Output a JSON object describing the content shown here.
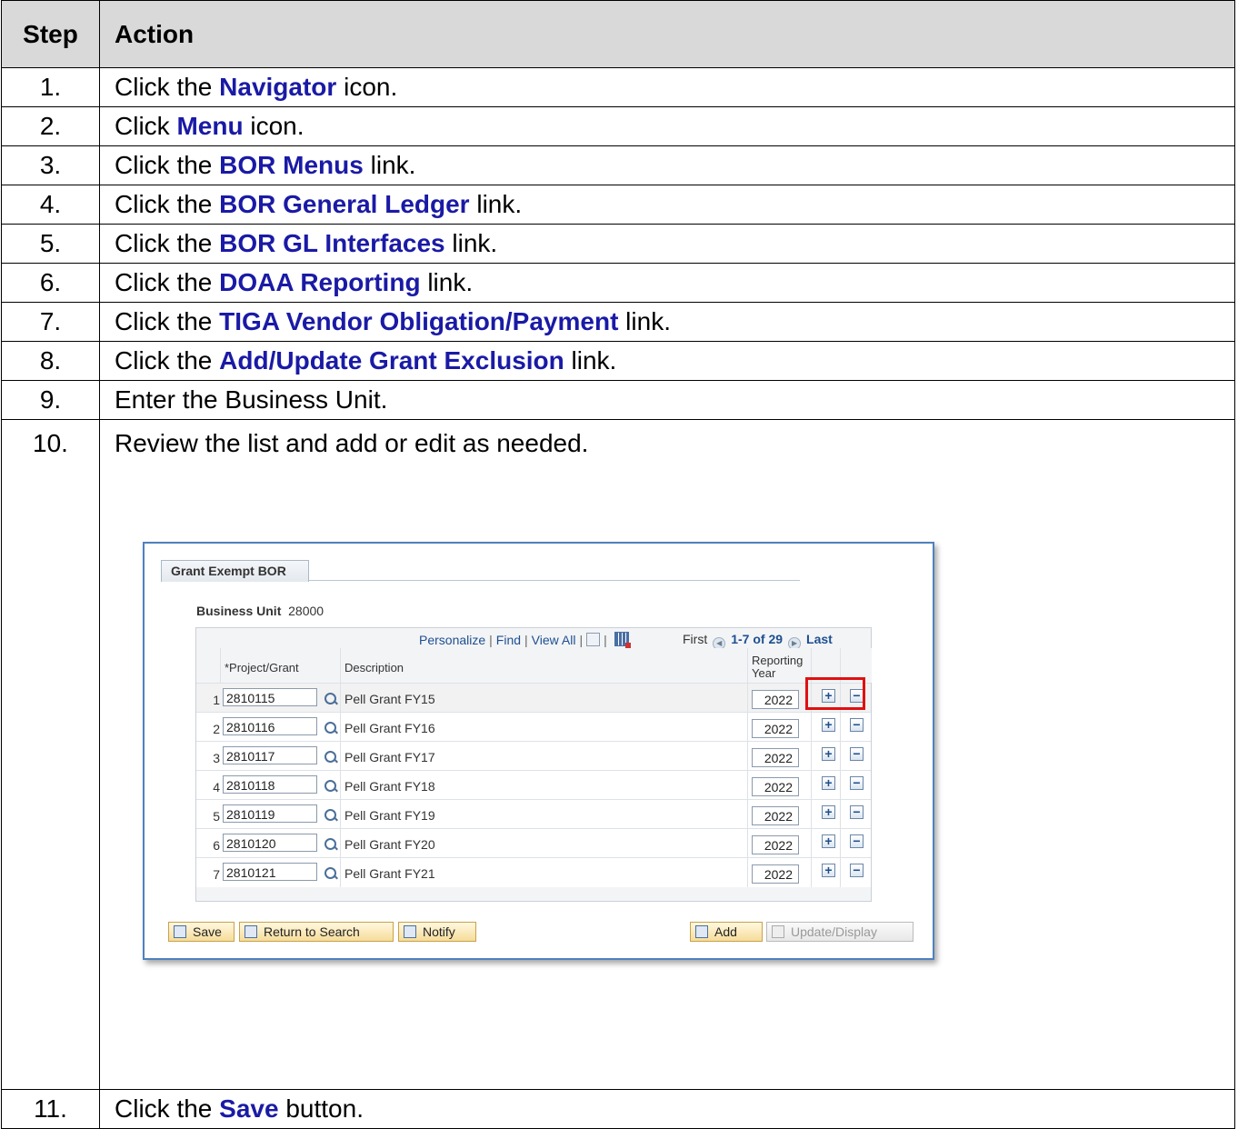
{
  "header": {
    "step": "Step",
    "action": "Action"
  },
  "steps": [
    {
      "num": "1.",
      "pre": "Click the ",
      "link": "Navigator",
      "post": " icon."
    },
    {
      "num": "2.",
      "pre": "Click ",
      "link": "Menu",
      "post": " icon."
    },
    {
      "num": "3.",
      "pre": "Click the ",
      "link": "BOR Menus",
      "post": " link."
    },
    {
      "num": "4.",
      "pre": "Click the ",
      "link": "BOR General Ledger",
      "post": " link."
    },
    {
      "num": "5.",
      "pre": "Click the ",
      "link": "BOR GL Interfaces",
      "post": " link."
    },
    {
      "num": "6.",
      "pre": "Click the ",
      "link": "DOAA Reporting",
      "post": " link."
    },
    {
      "num": "7.",
      "pre": "Click the ",
      "link": "TIGA Vendor Obligation/Payment",
      "post": " link."
    },
    {
      "num": "8.",
      "pre": "Click the ",
      "link": "Add/Update Grant Exclusion",
      "post": " link."
    },
    {
      "num": "9.",
      "text": "Enter the Business Unit."
    },
    {
      "num": "10.",
      "text": "Review the list and add or edit as needed."
    },
    {
      "num": "11.",
      "pre": "Click the ",
      "link": "Save",
      "post": " button."
    }
  ],
  "screenshot": {
    "tab": "Grant Exempt BOR",
    "business_unit_label": "Business Unit",
    "business_unit_value": "28000",
    "toolbar": {
      "personalize": "Personalize",
      "find": "Find",
      "view_all": "View All",
      "first": "First",
      "range": "1-7 of 29",
      "last": "Last"
    },
    "columns": {
      "project": "*Project/Grant",
      "description": "Description",
      "year": "Reporting Year"
    },
    "rows": [
      {
        "n": "1",
        "project": "2810115",
        "desc": "Pell Grant FY15",
        "year": "2022"
      },
      {
        "n": "2",
        "project": "2810116",
        "desc": "Pell Grant FY16",
        "year": "2022"
      },
      {
        "n": "3",
        "project": "2810117",
        "desc": "Pell Grant FY17",
        "year": "2022"
      },
      {
        "n": "4",
        "project": "2810118",
        "desc": "Pell Grant FY18",
        "year": "2022"
      },
      {
        "n": "5",
        "project": "2810119",
        "desc": "Pell Grant FY19",
        "year": "2022"
      },
      {
        "n": "6",
        "project": "2810120",
        "desc": "Pell Grant FY20",
        "year": "2022"
      },
      {
        "n": "7",
        "project": "2810121",
        "desc": "Pell Grant FY21",
        "year": "2022"
      }
    ],
    "buttons": {
      "save": "Save",
      "return": "Return to Search",
      "notify": "Notify",
      "add": "Add",
      "update": "Update/Display"
    },
    "plus": "+",
    "minus": "−"
  },
  "colors": {
    "link": "#1a1aa6",
    "header_bg": "#d9d9d9",
    "highlight": "#e01010"
  }
}
